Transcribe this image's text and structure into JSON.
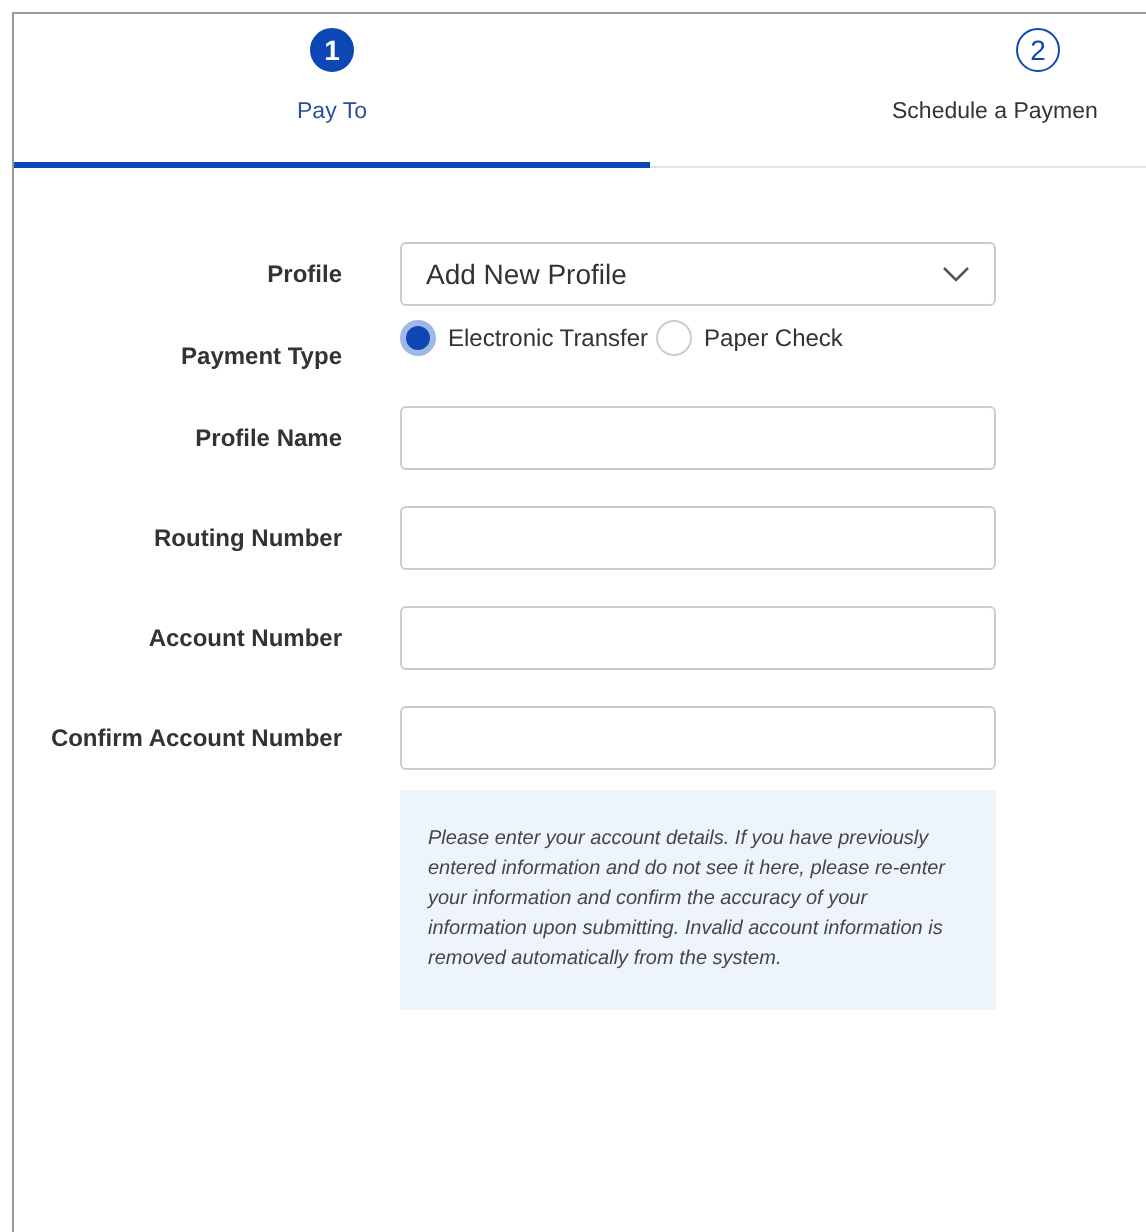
{
  "steps": [
    {
      "number": "1",
      "label": "Pay To",
      "selected": true
    },
    {
      "number": "2",
      "label": "Schedule a Paymen",
      "selected": false
    }
  ],
  "form": {
    "fields": [
      {
        "kind": "select",
        "label": "Profile",
        "value": "Add New Profile"
      },
      {
        "kind": "radio",
        "label": "Payment Type",
        "options": [
          {
            "label": "Electronic Transfer",
            "selected": true
          },
          {
            "label": "Paper Check",
            "selected": false
          }
        ]
      },
      {
        "kind": "text",
        "label": "Profile Name"
      },
      {
        "kind": "text",
        "label": "Routing Number"
      },
      {
        "kind": "text",
        "label": "Account Number"
      },
      {
        "kind": "text",
        "label": "Confirm Account Number"
      }
    ],
    "note": "Please enter your account details. If you have previously entered information and do not see it here, please re-enter your information and confirm the accuracy of your information upon submitting. Invalid account information is removed automatically from the system."
  }
}
